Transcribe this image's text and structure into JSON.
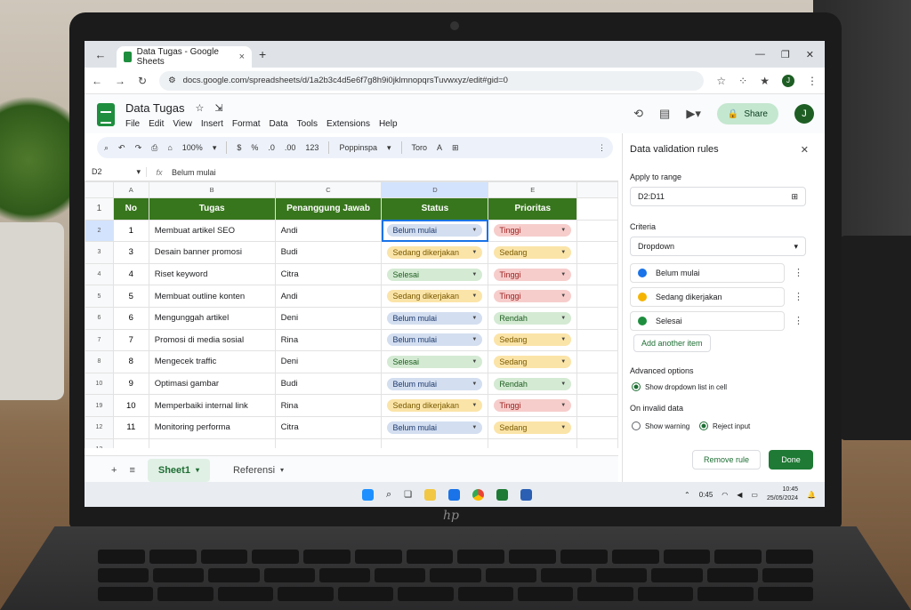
{
  "browser": {
    "tab_title": "Data Tugas - Google Sheets",
    "url": "docs.google.com/spreadsheets/d/1a2b3c4d5e6f7g8h9i0jklmnopqrsTuvwxyz/edit#gid=0"
  },
  "app": {
    "doc_title": "Data Tugas",
    "menus": [
      "File",
      "Edit",
      "View",
      "Insert",
      "Format",
      "Data",
      "Tools",
      "Extensions",
      "Help"
    ],
    "share_label": "Share",
    "avatar_letter": "J"
  },
  "toolbar": {
    "zoom": "100%",
    "currency": "$",
    "percent": "%",
    "dec_minus": ".0",
    "dec_plus": ".00",
    "num_format": "123",
    "font": "Poppinspa",
    "size": "Toro"
  },
  "formula_bar": {
    "cell_ref": "D2",
    "fx": "fx",
    "value": "Belum mulai"
  },
  "grid": {
    "column_letters": [
      "A",
      "B",
      "C",
      "D",
      "E"
    ],
    "headers": [
      "No",
      "Tugas",
      "Penanggung Jawab",
      "Status",
      "Prioritas"
    ],
    "row_numbers": [
      "1",
      "2",
      "3",
      "4",
      "5",
      "6",
      "7",
      "8",
      "10",
      "19",
      "12",
      "12"
    ],
    "rows": [
      {
        "no": "1",
        "tugas": "Membuat artikel SEO",
        "pj": "Andi",
        "status": "Belum mulai",
        "prioritas": "Tinggi"
      },
      {
        "no": "3",
        "tugas": "Desain banner promosi",
        "pj": "Budi",
        "status": "Sedang dikerjakan",
        "prioritas": "Sedang"
      },
      {
        "no": "4",
        "tugas": "Riset keyword",
        "pj": "Citra",
        "status": "Selesai",
        "prioritas": "Tinggi"
      },
      {
        "no": "5",
        "tugas": "Membuat outline konten",
        "pj": "Andi",
        "status": "Sedang dikerjakan",
        "prioritas": "Tinggi"
      },
      {
        "no": "6",
        "tugas": "Mengunggah artikel",
        "pj": "Deni",
        "status": "Belum mulai",
        "prioritas": "Rendah"
      },
      {
        "no": "7",
        "tugas": "Promosi di media sosial",
        "pj": "Rina",
        "status": "Belum mulai",
        "prioritas": "Sedang"
      },
      {
        "no": "8",
        "tugas": "Mengecek traffic",
        "pj": "Deni",
        "status": "Selesai",
        "prioritas": "Sedang"
      },
      {
        "no": "9",
        "tugas": "Optimasi gambar",
        "pj": "Budi",
        "status": "Belum mulai",
        "prioritas": "Rendah"
      },
      {
        "no": "10",
        "tugas": "Memperbaiki internal link",
        "pj": "Rina",
        "status": "Sedang dikerjakan",
        "prioritas": "Tinggi"
      },
      {
        "no": "11",
        "tugas": "Monitoring performa",
        "pj": "Citra",
        "status": "Belum mulai",
        "prioritas": "Sedang"
      }
    ]
  },
  "sheets": [
    "Sheet1",
    "Referensi"
  ],
  "panel": {
    "title": "Data validation rules",
    "apply_label": "Apply to range",
    "range": "D2:D11",
    "criteria_label": "Criteria",
    "criteria_value": "Dropdown",
    "options": [
      {
        "label": "Belum mulai",
        "color": "#1a73e8"
      },
      {
        "label": "Sedang dikerjakan",
        "color": "#f4b400"
      },
      {
        "label": "Selesai",
        "color": "#1e8e3e"
      }
    ],
    "add_item": "Add another item",
    "advanced_label": "Advanced options",
    "show_dropdown": "Show dropdown list in cell",
    "invalid_label": "On invalid data",
    "show_warning": "Show warning",
    "reject_input": "Reject input",
    "remove_rule": "Remove rule",
    "done": "Done"
  },
  "taskbar": {
    "time": "10:45",
    "date": "25/05/2024",
    "battery": "0:45"
  },
  "laptop_brand": "hp"
}
